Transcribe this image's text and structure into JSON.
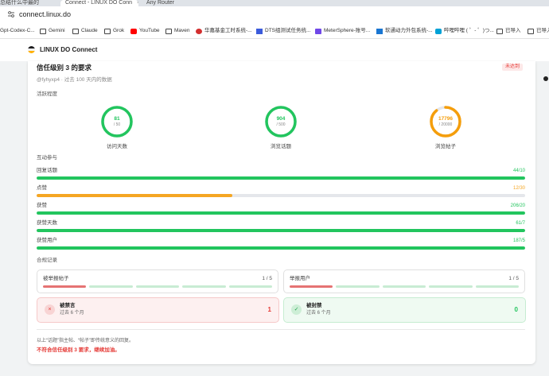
{
  "browser": {
    "tabs": [
      "总结什么中最的",
      "Connect - LINUX DO Conn",
      "Any Router"
    ],
    "tab_close": "×",
    "url": "connect.linux.do",
    "bookmarks": [
      "Gpt-Codex-C...",
      "Gemini",
      "Claude",
      "Grok",
      "YouTube",
      "Maven",
      "华嘉基金工时系统-...",
      "DTS组测试任务统...",
      "MeterSphere-账号...",
      "软通动力外包系统-...",
      "哔哩哔哩 ( ゜- ゜)つ...",
      "已导入",
      "已导入"
    ]
  },
  "site": {
    "brand": "LINUX DO Connect"
  },
  "card": {
    "title": "信任级别 3 的要求",
    "status_badge": "未达到",
    "subtitle": "@fyhyxp4 · 过去 100 天内的数据",
    "activity_label": "活跃程度",
    "gauges": [
      {
        "label": "访问天数",
        "value": "81",
        "max": "/ 50",
        "fraction": 1.0,
        "color": "#22c55e"
      },
      {
        "label": "浏览话题",
        "value": "904",
        "max": "/ 500",
        "fraction": 1.0,
        "color": "#22c55e"
      },
      {
        "label": "浏览帖子",
        "value": "17796",
        "max": "/ 20000",
        "fraction": 0.89,
        "color": "#f59e0b"
      }
    ],
    "interaction_label": "互动参与",
    "bars": [
      {
        "label": "回复话题",
        "value": "44/10",
        "fraction": 1.0,
        "color": "#22c55e"
      },
      {
        "label": "点赞",
        "value": "12/30",
        "fraction": 0.4,
        "color": "#f5a623"
      },
      {
        "label": "获赞",
        "value": "206/20",
        "fraction": 1.0,
        "color": "#22c55e"
      },
      {
        "label": "获赞天数",
        "value": "61/7",
        "fraction": 1.0,
        "color": "#22c55e"
      },
      {
        "label": "获赞用户",
        "value": "187/5",
        "fraction": 1.0,
        "color": "#22c55e"
      }
    ],
    "compliance_label": "合规记录",
    "reports": [
      {
        "label": "被举报帖子",
        "count": "1 / 5",
        "filled": 1,
        "total": 5
      },
      {
        "label": "举报用户",
        "count": "1 / 5",
        "filled": 1,
        "total": 5
      }
    ],
    "banned": {
      "title": "被禁言",
      "sub": "过去 6 个月",
      "num": "1",
      "icon": "×"
    },
    "blocked": {
      "title": "被封禁",
      "sub": "过去 6 个月",
      "num": "0",
      "icon": "✓"
    },
    "note": "以上“话题”指主帖、“帖子”即传统意义的回复。",
    "verdict": "不符合信任级别 3 要求，继续加油。"
  },
  "colors": {
    "green": "#22c55e",
    "orange": "#f59e0b",
    "red": "#e53935"
  }
}
